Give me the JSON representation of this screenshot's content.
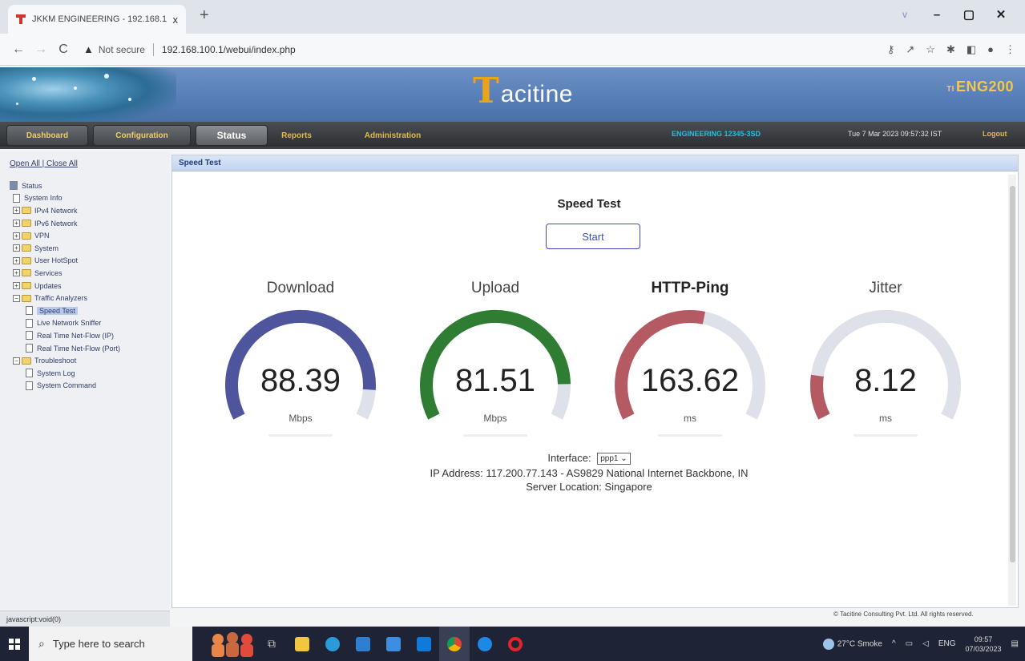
{
  "browser": {
    "tab_title": "JKKM ENGINEERING - 192.168.1",
    "tab_close": "x",
    "new_tab": "+",
    "not_secure": "Not secure",
    "url": "192.168.100.1/webui/index.php",
    "window_controls": {
      "chevron": "v",
      "minimize": "–",
      "maximize": "▢",
      "close": "✕"
    }
  },
  "header": {
    "brand_initial": "T",
    "brand_name": "acitine",
    "model_prefix": "TI",
    "model": "ENG200"
  },
  "menu": {
    "items": [
      "Dashboard",
      "Configuration",
      "Status",
      "Reports",
      "Administration"
    ],
    "active": "Status",
    "user": "ENGINEERING 12345-3SD",
    "datetime": "Tue 7 Mar 2023 09:57:32 IST",
    "logout": "Logout"
  },
  "sidebar": {
    "open_all": "Open All",
    "separator": " | ",
    "close_all": "Close All",
    "tree": [
      {
        "label": "Status",
        "level": 0,
        "type": "root"
      },
      {
        "label": "System Info",
        "level": 1,
        "type": "page"
      },
      {
        "label": "IPv4 Network",
        "level": 1,
        "type": "folder"
      },
      {
        "label": "IPv6 Network",
        "level": 1,
        "type": "folder"
      },
      {
        "label": "VPN",
        "level": 1,
        "type": "folder"
      },
      {
        "label": "System",
        "level": 1,
        "type": "folder"
      },
      {
        "label": "User HotSpot",
        "level": 1,
        "type": "folder"
      },
      {
        "label": "Services",
        "level": 1,
        "type": "folder"
      },
      {
        "label": "Updates",
        "level": 1,
        "type": "folder"
      },
      {
        "label": "Traffic Analyzers",
        "level": 1,
        "type": "folder-open"
      },
      {
        "label": "Speed Test",
        "level": 2,
        "type": "page",
        "selected": true
      },
      {
        "label": "Live Network Sniffer",
        "level": 2,
        "type": "page"
      },
      {
        "label": "Real Time Net-Flow (IP)",
        "level": 2,
        "type": "page"
      },
      {
        "label": "Real Time Net-Flow (Port)",
        "level": 2,
        "type": "page"
      },
      {
        "label": "Troubleshoot",
        "level": 1,
        "type": "folder-open"
      },
      {
        "label": "System Log",
        "level": 2,
        "type": "page"
      },
      {
        "label": "System Command",
        "level": 2,
        "type": "page"
      }
    ],
    "status_text": "javascript:void(0)"
  },
  "main": {
    "panel_title": "Speed Test",
    "heading": "Speed Test",
    "start_label": "Start",
    "gauges": [
      {
        "label": "Download",
        "value": "88.39",
        "unit": "Mbps",
        "fraction": 0.9,
        "color": "#4e559c",
        "bold": false
      },
      {
        "label": "Upload",
        "value": "81.51",
        "unit": "Mbps",
        "fraction": 0.88,
        "color": "#2e7d32",
        "bold": false
      },
      {
        "label": "HTTP-Ping",
        "value": "163.62",
        "unit": "ms",
        "fraction": 0.55,
        "color": "#b55a63",
        "bold": true
      },
      {
        "label": "Jitter",
        "value": "8.12",
        "unit": "ms",
        "fraction": 0.15,
        "color": "#b55a63",
        "bold": false
      }
    ],
    "track_color": "#dfe1ea",
    "interface_label": "Interface",
    "interface_value": "ppp1",
    "ip_address": "IP Address: 117.200.77.143 - AS9829 National Internet Backbone, IN",
    "server_location": "Server Location: Singapore",
    "copyright": "© Tacitine Consulting Pvt. Ltd. All rights reserved."
  },
  "taskbar": {
    "search_placeholder": "Type here to search",
    "weather": "27°C Smoke",
    "lang": "ENG",
    "time": "09:57",
    "date": "07/03/2023"
  }
}
